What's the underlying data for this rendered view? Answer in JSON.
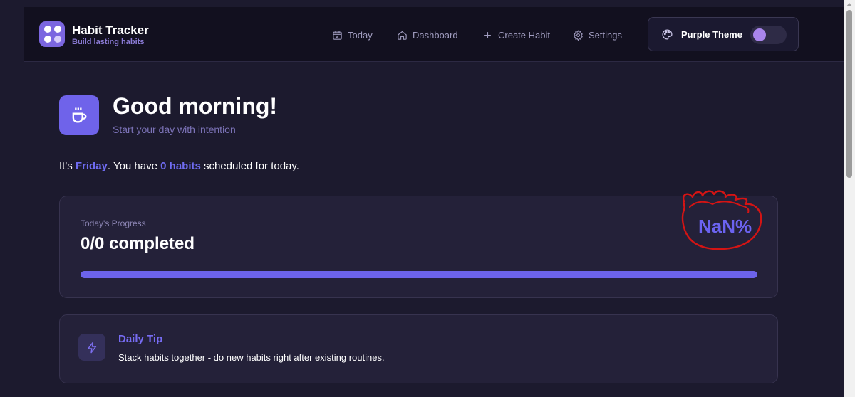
{
  "header": {
    "brand_title": "Habit Tracker",
    "brand_subtitle": "Build lasting habits",
    "nav": [
      {
        "label": "Today",
        "icon": "calendar-check-icon"
      },
      {
        "label": "Dashboard",
        "icon": "home-icon"
      },
      {
        "label": "Create Habit",
        "icon": "plus-icon"
      },
      {
        "label": "Settings",
        "icon": "gear-icon"
      }
    ],
    "theme": {
      "label": "Purple Theme",
      "icon": "palette-icon",
      "enabled": false
    }
  },
  "greeting": {
    "icon": "coffee-cup-icon",
    "title": "Good morning!",
    "subtitle": "Start your day with intention"
  },
  "summary": {
    "prefix": "It's ",
    "day": "Friday",
    "middle": ". You have ",
    "habits": "0 habits",
    "suffix": " scheduled for today."
  },
  "progress": {
    "label": "Today's Progress",
    "count_text": "0/0 completed",
    "percent_text": "NaN%",
    "bar_fill_fraction": 1.0
  },
  "tip": {
    "icon": "lightning-icon",
    "title": "Daily Tip",
    "text": "Stack habits together - do new habits right after existing routines."
  },
  "colors": {
    "background": "#1c1a2e",
    "header": "#12101f",
    "accent": "#6c63ea",
    "card": "#242139",
    "annotation": "#d41414"
  }
}
